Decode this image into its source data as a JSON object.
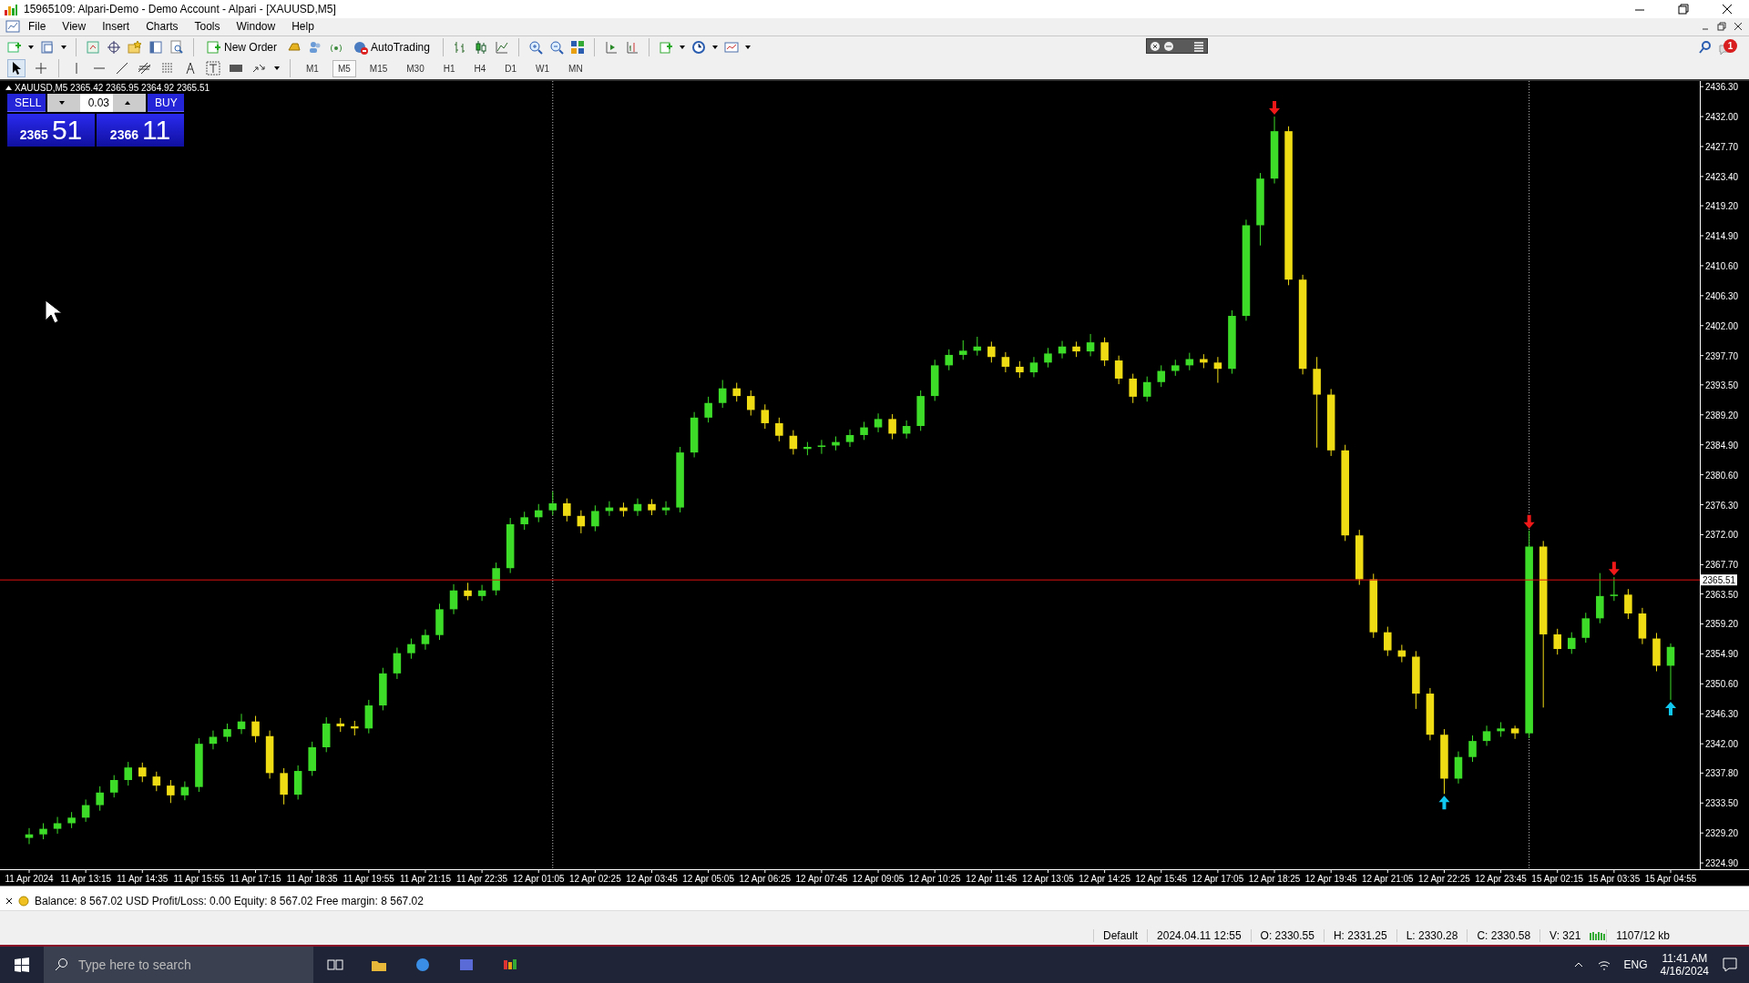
{
  "window": {
    "title": "15965109: Alpari-Demo - Demo Account - Alpari - [XAUUSD,M5]"
  },
  "menu": [
    "File",
    "View",
    "Insert",
    "Charts",
    "Tools",
    "Window",
    "Help"
  ],
  "toolbar": {
    "new_order": "New Order",
    "autotrading": "AutoTrading",
    "notifications": "1"
  },
  "timeframes": [
    {
      "label": "M1",
      "selected": false
    },
    {
      "label": "M5",
      "selected": true
    },
    {
      "label": "M15",
      "selected": false
    },
    {
      "label": "M30",
      "selected": false
    },
    {
      "label": "H1",
      "selected": false
    },
    {
      "label": "H4",
      "selected": false
    },
    {
      "label": "D1",
      "selected": false
    },
    {
      "label": "W1",
      "selected": false
    },
    {
      "label": "MN",
      "selected": false
    }
  ],
  "chart": {
    "header": "XAUUSD,M5  2365.42 2365.95 2364.92 2365.51",
    "one_click": {
      "sell": "SELL",
      "buy": "BUY",
      "lot": "0.03",
      "bid_big": "2365",
      "bid_small": "51",
      "ask_big": "2366",
      "ask_small": "11"
    },
    "signals": [
      {
        "kind": "sell"
      },
      {
        "kind": "sell"
      },
      {
        "kind": "sell"
      },
      {
        "kind": "buy"
      },
      {
        "kind": "buy"
      }
    ],
    "chart_data": {
      "type": "candlestick",
      "ylim": [
        2324.0,
        2437.1
      ],
      "ref_lines": [
        {
          "axis": "y",
          "value": 2365.51,
          "label": "2365.51"
        }
      ],
      "yticks": [
        {
          "value": 2436.3,
          "label": "2436.30"
        },
        {
          "value": 2432,
          "label": "2432.00"
        },
        {
          "value": 2427.7,
          "label": "2427.70"
        },
        {
          "value": 2423.4,
          "label": "2423.40"
        },
        {
          "value": 2419.2,
          "label": "2419.20"
        },
        {
          "value": 2414.9,
          "label": "2414.90"
        },
        {
          "value": 2410.6,
          "label": "2410.60"
        },
        {
          "value": 2406.3,
          "label": "2406.30"
        },
        {
          "value": 2402,
          "label": "2402.00"
        },
        {
          "value": 2397.7,
          "label": "2397.70"
        },
        {
          "value": 2393.5,
          "label": "2393.50"
        },
        {
          "value": 2389.2,
          "label": "2389.20"
        },
        {
          "value": 2384.9,
          "label": "2384.90"
        },
        {
          "value": 2380.6,
          "label": "2380.60"
        },
        {
          "value": 2376.3,
          "label": "2376.30"
        },
        {
          "value": 2372,
          "label": "2372.00"
        },
        {
          "value": 2367.7,
          "label": "2367.70"
        },
        {
          "value": 2363.5,
          "label": "2363.50"
        },
        {
          "value": 2359.2,
          "label": "2359.20"
        },
        {
          "value": 2354.9,
          "label": "2354.90"
        },
        {
          "value": 2350.6,
          "label": "2350.60"
        },
        {
          "value": 2346.3,
          "label": "2346.30"
        },
        {
          "value": 2342,
          "label": "2342.00"
        },
        {
          "value": 2337.8,
          "label": "2337.80"
        },
        {
          "value": 2333.5,
          "label": "2333.50"
        },
        {
          "value": 2329.2,
          "label": "2329.20"
        },
        {
          "value": 2324.9,
          "label": "2324.90"
        }
      ],
      "categories": [
        "11 Apr 2024",
        null,
        null,
        null,
        "11 Apr 13:15",
        null,
        null,
        null,
        "11 Apr 14:35",
        null,
        null,
        null,
        "11 Apr 15:55",
        null,
        null,
        null,
        "11 Apr 17:15",
        null,
        null,
        null,
        "11 Apr 18:35",
        null,
        null,
        null,
        "11 Apr 19:55",
        null,
        null,
        null,
        "11 Apr 21:15",
        null,
        null,
        null,
        "11 Apr 22:35",
        null,
        null,
        null,
        "12 Apr 01:05",
        null,
        null,
        null,
        "12 Apr 02:25",
        null,
        null,
        null,
        "12 Apr 03:45",
        null,
        null,
        null,
        "12 Apr 05:05",
        null,
        null,
        null,
        "12 Apr 06:25",
        null,
        null,
        null,
        "12 Apr 07:45",
        null,
        null,
        null,
        "12 Apr 09:05",
        null,
        null,
        null,
        "12 Apr 10:25",
        null,
        null,
        null,
        "12 Apr 11:45",
        null,
        null,
        null,
        "12 Apr 13:05",
        null,
        null,
        null,
        "12 Apr 14:25",
        null,
        null,
        null,
        "12 Apr 15:45",
        null,
        null,
        null,
        "12 Apr 17:05",
        null,
        null,
        null,
        "12 Apr 18:25",
        null,
        null,
        null,
        "12 Apr 19:45",
        null,
        null,
        null,
        "12 Apr 21:05",
        null,
        null,
        null,
        "12 Apr 22:25",
        null,
        null,
        null,
        "12 Apr 23:45",
        null,
        null,
        null,
        "15 Apr 02:15",
        null,
        null,
        null,
        "15 Apr 03:35",
        null,
        null,
        null,
        "15 Apr 04:55"
      ],
      "ohlc": [
        [
          2328.5,
          2329.9,
          2327.6,
          2329.0
        ],
        [
          2329.0,
          2330.6,
          2328.3,
          2329.8
        ],
        [
          2329.8,
          2331.5,
          2329.1,
          2330.6
        ],
        [
          2330.6,
          2332.2,
          2329.9,
          2331.4
        ],
        [
          2331.4,
          2334.0,
          2330.8,
          2333.2
        ],
        [
          2333.2,
          2335.9,
          2332.4,
          2335.0
        ],
        [
          2335.0,
          2337.5,
          2334.3,
          2336.8
        ],
        [
          2336.8,
          2339.4,
          2336.0,
          2338.6
        ],
        [
          2338.6,
          2339.3,
          2336.5,
          2337.3
        ],
        [
          2337.3,
          2338.0,
          2335.2,
          2336.0
        ],
        [
          2336.0,
          2336.8,
          2333.5,
          2334.6
        ],
        [
          2334.6,
          2336.6,
          2333.9,
          2335.8
        ],
        [
          2335.8,
          2342.8,
          2335.1,
          2342.0
        ],
        [
          2342.0,
          2343.9,
          2341.2,
          2343.0
        ],
        [
          2343.0,
          2344.9,
          2342.3,
          2344.1
        ],
        [
          2344.1,
          2346.3,
          2343.4,
          2345.2
        ],
        [
          2345.2,
          2346.0,
          2342.2,
          2343.1
        ],
        [
          2343.1,
          2343.9,
          2337.0,
          2337.8
        ],
        [
          2337.8,
          2338.5,
          2333.3,
          2334.7
        ],
        [
          2334.7,
          2338.9,
          2334.0,
          2338.1
        ],
        [
          2338.1,
          2342.3,
          2337.4,
          2341.5
        ],
        [
          2341.5,
          2345.8,
          2340.8,
          2344.9
        ],
        [
          2344.9,
          2345.7,
          2343.7,
          2344.5
        ],
        [
          2344.5,
          2345.3,
          2343.2,
          2344.2
        ],
        [
          2344.2,
          2348.3,
          2343.5,
          2347.5
        ],
        [
          2347.5,
          2352.9,
          2346.8,
          2352.1
        ],
        [
          2352.1,
          2355.8,
          2351.3,
          2355.0
        ],
        [
          2355.0,
          2357.1,
          2354.2,
          2356.3
        ],
        [
          2356.3,
          2358.4,
          2355.5,
          2357.6
        ],
        [
          2357.6,
          2362.1,
          2356.9,
          2361.3
        ],
        [
          2361.3,
          2364.9,
          2360.6,
          2364.0
        ],
        [
          2364.0,
          2365.1,
          2362.6,
          2363.2
        ],
        [
          2363.2,
          2364.8,
          2362.5,
          2364.0
        ],
        [
          2364.0,
          2368.0,
          2363.3,
          2367.2
        ],
        [
          2367.2,
          2374.4,
          2366.5,
          2373.5
        ],
        [
          2373.5,
          2375.3,
          2372.7,
          2374.5
        ],
        [
          2374.5,
          2376.4,
          2373.8,
          2375.5
        ],
        [
          2375.5,
          2378.2,
          2374.8,
          2376.5
        ],
        [
          2376.5,
          2377.2,
          2373.9,
          2374.7
        ],
        [
          2374.7,
          2375.5,
          2372.2,
          2373.2
        ],
        [
          2373.2,
          2376.2,
          2372.5,
          2375.4
        ],
        [
          2375.4,
          2376.8,
          2374.7,
          2375.9
        ],
        [
          2375.9,
          2376.6,
          2374.6,
          2375.4
        ],
        [
          2375.4,
          2377.2,
          2374.7,
          2376.4
        ],
        [
          2376.4,
          2377.1,
          2374.8,
          2375.5
        ],
        [
          2375.5,
          2376.8,
          2374.8,
          2375.9
        ],
        [
          2375.9,
          2384.6,
          2375.2,
          2383.8
        ],
        [
          2383.8,
          2389.6,
          2383.1,
          2388.8
        ],
        [
          2388.8,
          2391.8,
          2388.1,
          2390.9
        ],
        [
          2390.9,
          2394.2,
          2390.2,
          2393.0
        ],
        [
          2393.0,
          2393.8,
          2391.1,
          2391.9
        ],
        [
          2391.9,
          2392.7,
          2389.1,
          2389.9
        ],
        [
          2389.9,
          2390.7,
          2387.2,
          2388.0
        ],
        [
          2388.0,
          2388.8,
          2385.4,
          2386.2
        ],
        [
          2386.2,
          2387.0,
          2383.5,
          2384.3
        ],
        [
          2384.3,
          2385.3,
          2383.4,
          2384.6
        ],
        [
          2384.6,
          2385.6,
          2383.6,
          2384.8
        ],
        [
          2384.8,
          2386.1,
          2384.1,
          2385.3
        ],
        [
          2385.3,
          2387.1,
          2384.6,
          2386.3
        ],
        [
          2386.3,
          2388.2,
          2385.6,
          2387.4
        ],
        [
          2387.4,
          2389.4,
          2386.7,
          2388.6
        ],
        [
          2388.6,
          2389.3,
          2385.7,
          2386.5
        ],
        [
          2386.5,
          2388.4,
          2385.8,
          2387.6
        ],
        [
          2387.6,
          2392.7,
          2386.9,
          2391.9
        ],
        [
          2391.9,
          2397.1,
          2391.2,
          2396.3
        ],
        [
          2396.3,
          2398.6,
          2395.6,
          2397.8
        ],
        [
          2397.8,
          2399.9,
          2397.1,
          2398.4
        ],
        [
          2398.4,
          2400.4,
          2397.7,
          2399.0
        ],
        [
          2399.0,
          2399.7,
          2396.7,
          2397.5
        ],
        [
          2397.5,
          2398.2,
          2395.3,
          2396.1
        ],
        [
          2396.1,
          2396.9,
          2394.5,
          2395.3
        ],
        [
          2395.3,
          2397.5,
          2394.6,
          2396.7
        ],
        [
          2396.7,
          2398.8,
          2396.0,
          2398.0
        ],
        [
          2398.0,
          2399.8,
          2397.3,
          2399.0
        ],
        [
          2399.0,
          2399.7,
          2397.5,
          2398.3
        ],
        [
          2398.3,
          2400.8,
          2397.6,
          2399.6
        ],
        [
          2399.6,
          2400.3,
          2396.2,
          2397.0
        ],
        [
          2397.0,
          2397.7,
          2393.6,
          2394.4
        ],
        [
          2394.4,
          2395.1,
          2390.9,
          2391.8
        ],
        [
          2391.8,
          2394.7,
          2391.1,
          2393.9
        ],
        [
          2393.9,
          2396.3,
          2393.2,
          2395.5
        ],
        [
          2395.5,
          2397.1,
          2394.8,
          2396.3
        ],
        [
          2396.3,
          2398.1,
          2395.6,
          2397.2
        ],
        [
          2397.2,
          2397.9,
          2395.9,
          2396.7
        ],
        [
          2396.7,
          2397.5,
          2393.8,
          2395.8
        ],
        [
          2395.8,
          2404.2,
          2395.1,
          2403.4
        ],
        [
          2403.4,
          2417.2,
          2402.7,
          2416.4
        ],
        [
          2416.4,
          2423.9,
          2413.5,
          2423.1
        ],
        [
          2423.1,
          2432.0,
          2422.4,
          2429.9
        ],
        [
          2429.9,
          2430.6,
          2407.8,
          2408.6
        ],
        [
          2408.6,
          2409.3,
          2395.0,
          2395.8
        ],
        [
          2395.8,
          2397.5,
          2384.5,
          2392.1
        ],
        [
          2392.1,
          2392.9,
          2383.3,
          2384.1
        ],
        [
          2384.1,
          2384.9,
          2371.1,
          2371.9
        ],
        [
          2371.9,
          2372.7,
          2364.8,
          2365.6
        ],
        [
          2365.6,
          2366.4,
          2357.2,
          2358.0
        ],
        [
          2358.0,
          2358.8,
          2354.6,
          2355.4
        ],
        [
          2355.4,
          2356.2,
          2353.7,
          2354.5
        ],
        [
          2354.5,
          2355.3,
          2347.0,
          2349.2
        ],
        [
          2349.2,
          2350.0,
          2342.5,
          2343.3
        ],
        [
          2343.3,
          2344.1,
          2334.8,
          2337.0
        ],
        [
          2337.0,
          2340.9,
          2336.3,
          2340.1
        ],
        [
          2340.1,
          2343.2,
          2339.4,
          2342.4
        ],
        [
          2342.4,
          2344.6,
          2341.7,
          2343.8
        ],
        [
          2343.8,
          2345.1,
          2343.0,
          2344.2
        ],
        [
          2344.2,
          2344.6,
          2342.7,
          2343.5
        ],
        [
          2343.5,
          2372.6,
          2342.8,
          2370.3
        ],
        [
          2370.3,
          2371.1,
          2347.2,
          2357.7
        ],
        [
          2357.7,
          2358.5,
          2354.8,
          2355.6
        ],
        [
          2355.6,
          2358.0,
          2354.9,
          2357.2
        ],
        [
          2357.2,
          2360.8,
          2356.5,
          2360.0
        ],
        [
          2360.0,
          2366.5,
          2359.3,
          2363.2
        ],
        [
          2363.2,
          2365.9,
          2362.5,
          2363.4
        ],
        [
          2363.4,
          2364.2,
          2359.9,
          2360.7
        ],
        [
          2360.7,
          2361.5,
          2356.3,
          2357.1
        ],
        [
          2357.1,
          2357.9,
          2352.4,
          2353.2
        ],
        [
          2353.2,
          2356.4,
          2348.3,
          2355.9
        ]
      ]
    }
  },
  "terminal": {
    "account": "Balance: 8 567.02 USD  Profit/Loss: 0.00  Equity: 8 567.02  Free margin: 8 567.02"
  },
  "status_bar": [
    "Default",
    "2024.04.11 12:55",
    "O: 2330.55",
    "H: 2331.25",
    "L: 2330.28",
    "C: 2330.58",
    "V: 321",
    "1107/12 kb"
  ],
  "taskbar": {
    "search_placeholder": "Type here to search",
    "language": "ENG",
    "time": "11:41 AM",
    "date": "4/16/2024"
  }
}
